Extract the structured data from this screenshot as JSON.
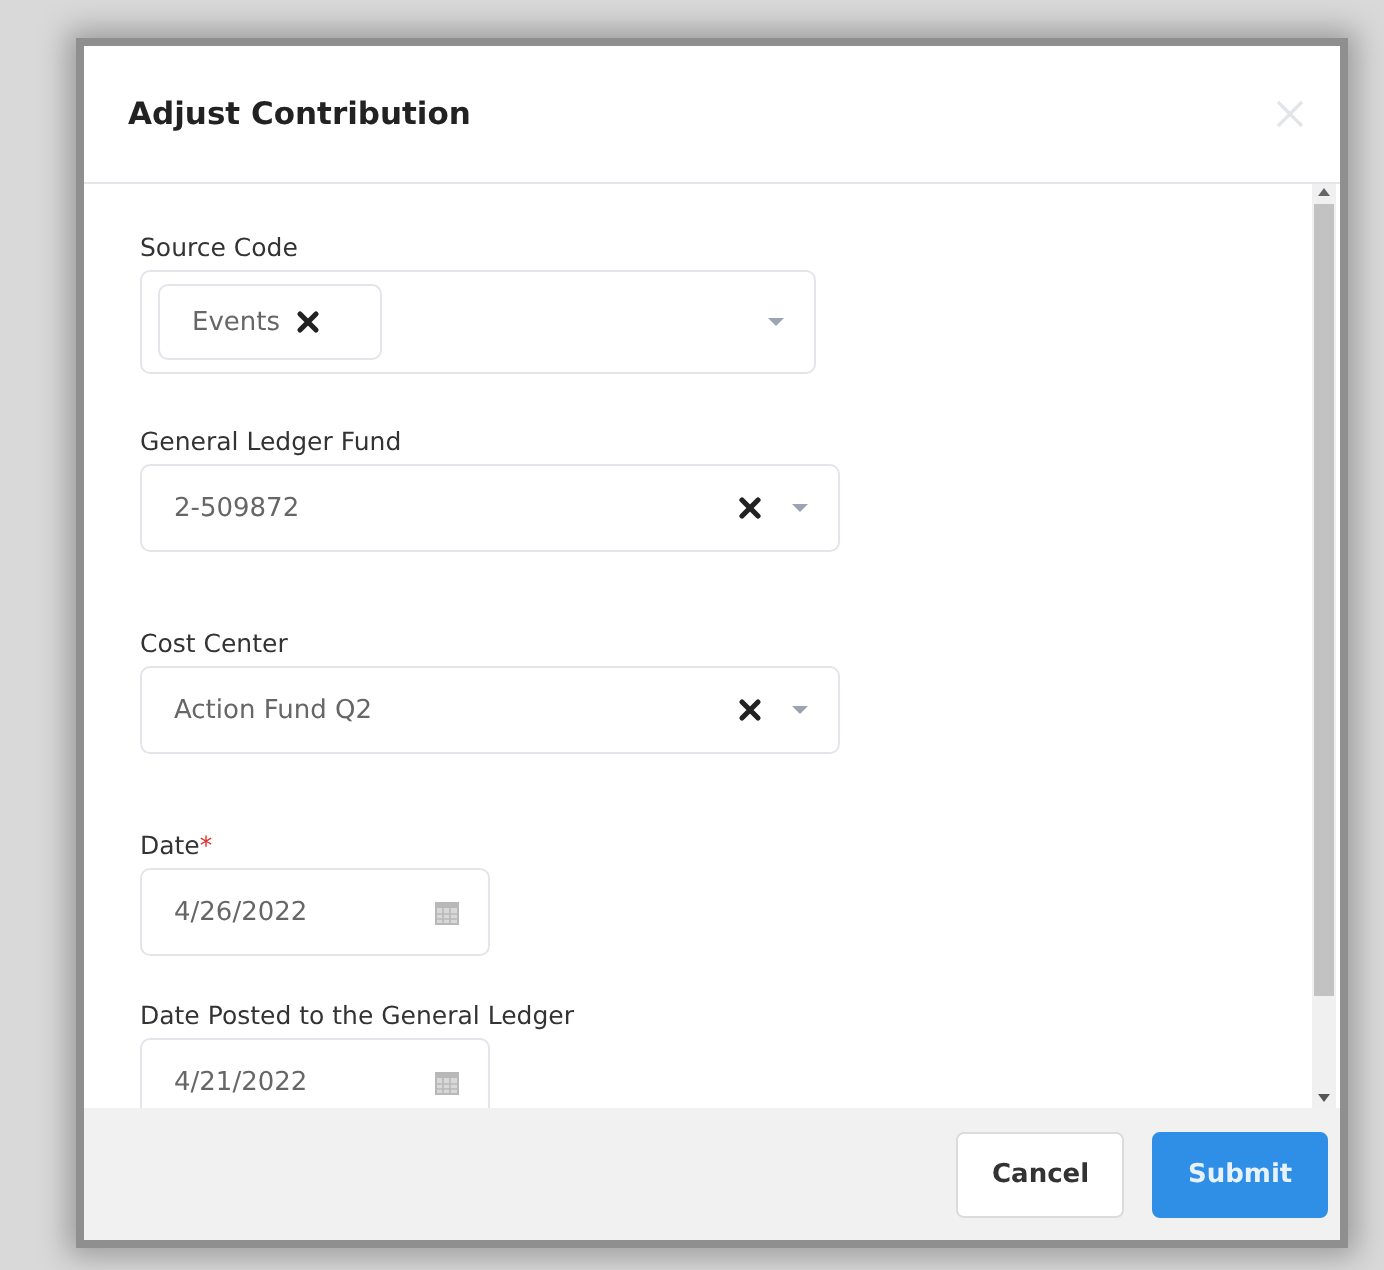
{
  "dialog": {
    "title": "Adjust Contribution",
    "fields": [
      {
        "kind": "multiselect",
        "label": "Source Code",
        "tags": [
          "Events"
        ]
      },
      {
        "kind": "select",
        "label": "General Ledger Fund",
        "value": "2-509872"
      },
      {
        "kind": "select",
        "label": "Cost Center",
        "value": "Action Fund Q2"
      },
      {
        "kind": "date",
        "label": "Date",
        "required_mark": "*",
        "value": "4/26/2022"
      },
      {
        "kind": "date",
        "label": "Date Posted to the General Ledger",
        "value": "4/21/2022"
      }
    ],
    "buttons": [
      {
        "kind": "secondary",
        "label": "Cancel"
      },
      {
        "kind": "primary",
        "label": "Submit"
      }
    ]
  }
}
